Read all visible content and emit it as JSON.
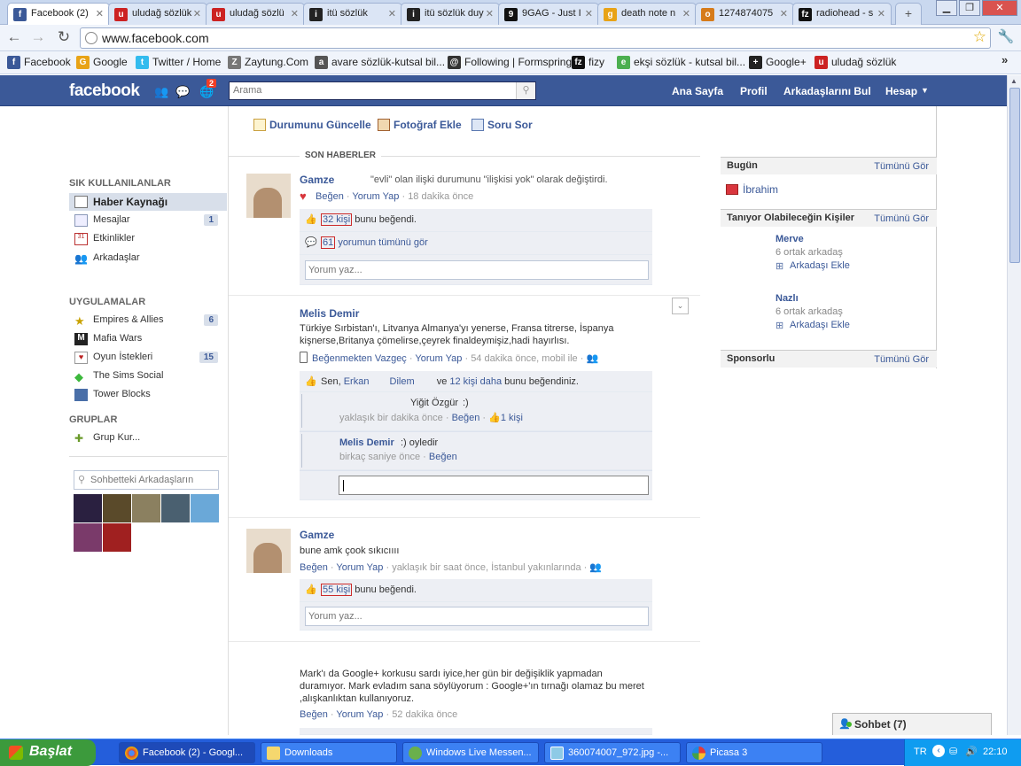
{
  "browser": {
    "tabs": [
      {
        "title": "Facebook (2)",
        "icon": "facebook-favicon"
      },
      {
        "title": "uludağ sözlük",
        "icon": "uludag-favicon"
      },
      {
        "title": "uludağ sözlü",
        "icon": "uludag-favicon"
      },
      {
        "title": "itü sözlük",
        "icon": "itu-favicon"
      },
      {
        "title": "itü sözlük duy",
        "icon": "itu-favicon"
      },
      {
        "title": "9GAG - Just I",
        "icon": "9gag-favicon"
      },
      {
        "title": "death note n",
        "icon": "google-favicon"
      },
      {
        "title": "1274874075",
        "icon": "generic-favicon"
      },
      {
        "title": "radiohead - s",
        "icon": "fizy-favicon"
      }
    ],
    "url": "www.facebook.com",
    "bookmarks": [
      {
        "label": "Facebook",
        "color": "#3b5998",
        "glyph": "f"
      },
      {
        "label": "Google",
        "color": "#e8a317",
        "glyph": "G"
      },
      {
        "label": "Twitter / Home",
        "color": "#33bbee",
        "glyph": "t"
      },
      {
        "label": "Zaytung.Com",
        "color": "#777777",
        "glyph": "Z"
      },
      {
        "label": "avare sözlük-kutsal bil...",
        "color": "#555555",
        "glyph": "a"
      },
      {
        "label": "Following | Formspring",
        "color": "#333333",
        "glyph": "@"
      },
      {
        "label": "fizy",
        "color": "#111111",
        "glyph": "fz"
      },
      {
        "label": "ekşi sözlük - kutsal bil...",
        "color": "#4caf50",
        "glyph": "e"
      },
      {
        "label": "Google+",
        "color": "#222222",
        "glyph": "+"
      },
      {
        "label": "uludağ sözlük",
        "color": "#cc2222",
        "glyph": "u"
      }
    ]
  },
  "fb_header": {
    "logo": "facebook",
    "notification_count": "2",
    "search_placeholder": "Arama",
    "nav": [
      "Ana Sayfa",
      "Profil",
      "Arkadaşlarını Bul",
      "Hesap"
    ]
  },
  "left_nav": {
    "fav_heading": "SIK KULLANILANLAR",
    "favorites": [
      {
        "label": "Haber Kaynağı",
        "count": ""
      },
      {
        "label": "Mesajlar",
        "count": "1"
      },
      {
        "label": "Etkinlikler",
        "count": ""
      },
      {
        "label": "Arkadaşlar",
        "count": ""
      }
    ],
    "apps_heading": "UYGULAMALAR",
    "apps": [
      {
        "label": "Empires & Allies",
        "count": "6"
      },
      {
        "label": "Mafia Wars",
        "count": ""
      },
      {
        "label": "Oyun İstekleri",
        "count": "15"
      },
      {
        "label": "The Sims Social",
        "count": ""
      },
      {
        "label": "Tower Blocks",
        "count": ""
      }
    ],
    "groups_heading": "GRUPLAR",
    "groups": [
      {
        "label": "Grup Kur..."
      }
    ],
    "chat_search_placeholder": "Sohbetteki Arkadaşların"
  },
  "composer": {
    "status": "Durumunu Güncelle",
    "photo": "Fotoğraf Ekle",
    "question": "Soru Sor"
  },
  "feed": {
    "heading": "SON HABERLER",
    "stories": [
      {
        "name": "Gamze",
        "text": "\"evli\" olan ilişki durumunu \"ilişkisi yok\" olarak değiştirdi.",
        "like": "Beğen",
        "comment": "Yorum Yap",
        "time": "18 dakika önce",
        "likes_link": "32 kişi",
        "likes_suffix": "bunu beğendi.",
        "comments_count": "61",
        "comments_suffix": "yorumun tümünü gör",
        "comment_placeholder": "Yorum yaz..."
      },
      {
        "name": "Melis Demir",
        "text": "Türkiye Sırbistan'ı, Litvanya Almanya'yı yenerse, Fransa titrerse, İspanya kişnerse,Britanya çömelirse,çeyrek finaldeymişiz,hadi hayırlısı.",
        "unlike": "Beğenmekten Vazgeç",
        "comment": "Yorum Yap",
        "time": "54 dakika önce, mobil ile",
        "likes_prefix": "Sen,",
        "liker1": "Erkan",
        "liker2": "Dilem",
        "likes_and": "ve",
        "likes_more": "12 kişi daha",
        "likes_suffix": "bunu beğendiniz.",
        "comments": [
          {
            "name": "Yiğit Özgür",
            "text": ":)",
            "time": "yaklaşık bir dakika önce",
            "like": "Beğen",
            "likes": "1 kişi"
          },
          {
            "name": "Melis Demir",
            "text": ":) oyledir",
            "time": "birkaç saniye önce",
            "like": "Beğen"
          }
        ]
      },
      {
        "name": "Gamze",
        "text": "bune amk çook sıkıcıııı",
        "like": "Beğen",
        "comment": "Yorum Yap",
        "time": "yaklaşık bir saat önce, İstanbul yakınlarında",
        "likes_link": "55 kişi",
        "likes_suffix": "bunu beğendi.",
        "comment_placeholder": "Yorum yaz..."
      },
      {
        "text": "Mark'ı da Google+ korkusu sardı iyice,her gün bir değişiklik yapmadan duramıyor. Mark evladım sana söylüyorum : Google+'ın tırnağı olamaz bu meret ,alışkanlıktan kullanıyoruz.",
        "like": "Beğen",
        "comment": "Yorum Yap",
        "time": "52 dakika önce"
      }
    ]
  },
  "right_col": {
    "today": {
      "heading": "Bugün",
      "see_all": "Tümünü Gör",
      "birthday": "İbrahim"
    },
    "pymk": {
      "heading": "Tanıyor Olabileceğin Kişiler",
      "see_all": "Tümünü Gör",
      "people": [
        {
          "name": "Merve",
          "mutual": "6 ortak arkadaş",
          "add": "Arkadaşı Ekle"
        },
        {
          "name": "Nazlı",
          "mutual": "6 ortak arkadaş",
          "add": "Arkadaşı Ekle"
        }
      ]
    },
    "sponsored": {
      "heading": "Sponsorlu",
      "see_all": "Tümünü Gör"
    }
  },
  "chat": {
    "label": "Sohbet (7)"
  },
  "taskbar": {
    "start": "Başlat",
    "tasks": [
      "Facebook (2) - Googl...",
      "Downloads",
      "Windows Live Messen...",
      "360074007_972.jpg -...",
      "Picasa 3"
    ],
    "lang": "TR",
    "clock": "22:10"
  }
}
